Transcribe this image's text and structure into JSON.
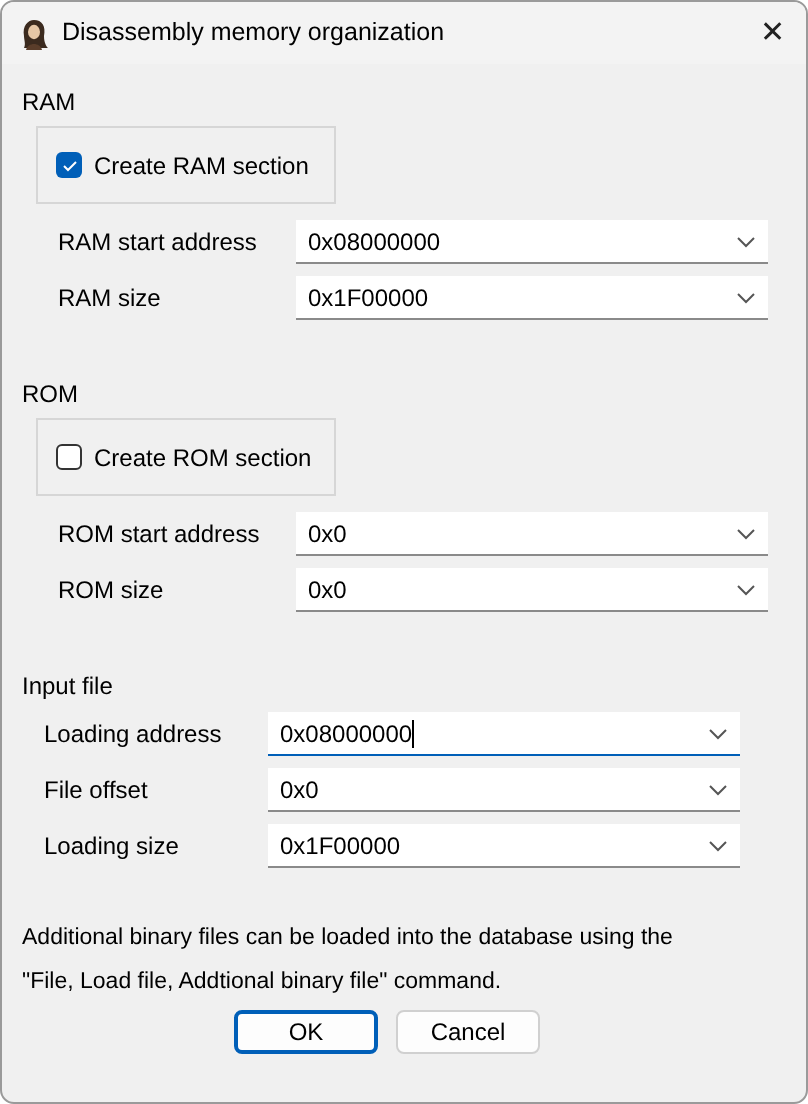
{
  "window": {
    "title": "Disassembly memory organization",
    "close": "✕"
  },
  "sections": [
    {
      "title": "RAM",
      "checkbox": {
        "label": "Create RAM section",
        "checked": true
      },
      "fields": [
        {
          "label": "RAM start address",
          "value": "0x08000000",
          "focused": false
        },
        {
          "label": "RAM size",
          "value": "0x1F00000",
          "focused": false
        }
      ]
    },
    {
      "title": "ROM",
      "checkbox": {
        "label": "Create ROM section",
        "checked": false
      },
      "fields": [
        {
          "label": "ROM start address",
          "value": "0x0",
          "focused": false
        },
        {
          "label": "ROM size",
          "value": "0x0",
          "focused": false
        }
      ]
    },
    {
      "title": "Input file",
      "fields": [
        {
          "label": "Loading address",
          "value": "0x08000000",
          "focused": true
        },
        {
          "label": "File offset",
          "value": "0x0",
          "focused": false
        },
        {
          "label": "Loading size",
          "value": "0x1F00000",
          "focused": false
        }
      ]
    }
  ],
  "note": [
    "Additional binary files can be loaded into the database using the",
    "\"File, Load file, Addtional binary file\" command."
  ],
  "buttons": [
    {
      "label": "OK",
      "default": true
    },
    {
      "label": "Cancel",
      "default": false
    }
  ]
}
